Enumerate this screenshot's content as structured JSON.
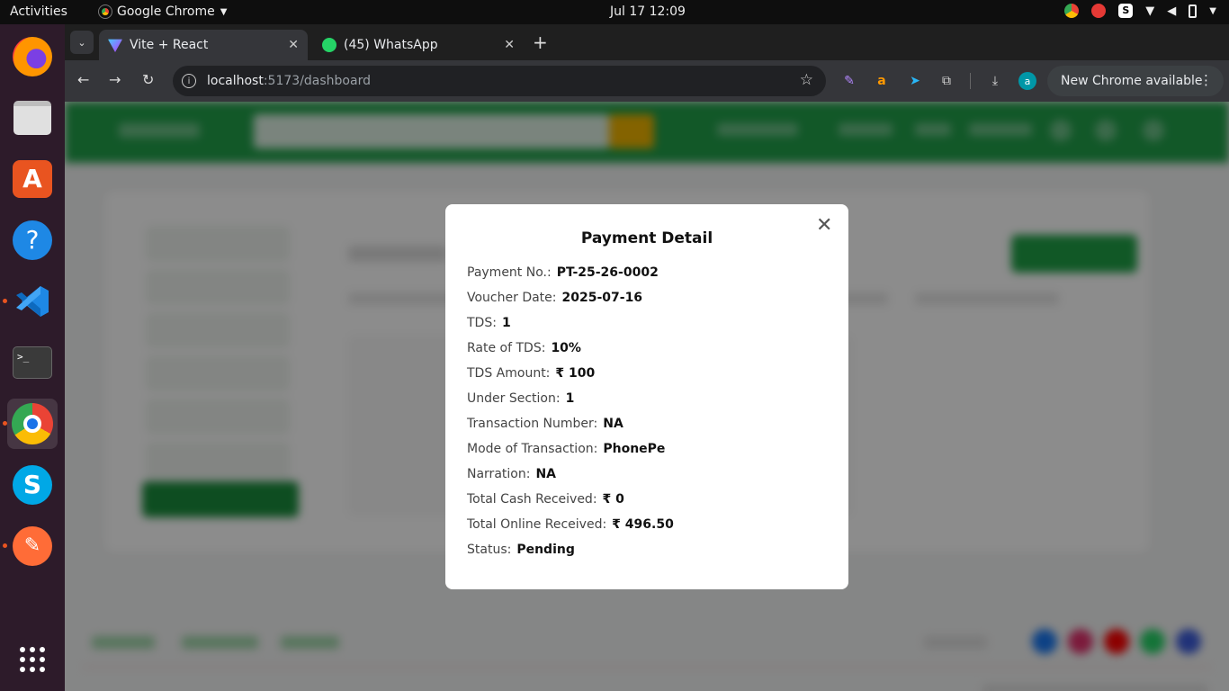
{
  "topbar": {
    "activities": "Activities",
    "app_name": "Google Chrome",
    "clock": "Jul 17  12:09"
  },
  "browser": {
    "tabs": [
      {
        "title": "Vite + React",
        "active": true
      },
      {
        "title": "(45) WhatsApp",
        "active": false
      }
    ],
    "url_host": "localhost",
    "url_rest": ":5173/dashboard",
    "update_label": "New Chrome available",
    "profile_initial": "a"
  },
  "modal": {
    "title": "Payment Detail",
    "fields": [
      {
        "label": "Payment No.:",
        "value": "PT-25-26-0002"
      },
      {
        "label": "Voucher Date:",
        "value": "2025-07-16"
      },
      {
        "label": "TDS:",
        "value": "1"
      },
      {
        "label": "Rate of TDS:",
        "value": "10%"
      },
      {
        "label": "TDS Amount:",
        "value": "₹ 100"
      },
      {
        "label": "Under Section:",
        "value": "1"
      },
      {
        "label": "Transaction Number:",
        "value": "NA"
      },
      {
        "label": "Mode of Transaction:",
        "value": "PhonePe"
      },
      {
        "label": "Narration:",
        "value": "NA"
      },
      {
        "label": "Total Cash Received:",
        "value": "₹ 0"
      },
      {
        "label": "Total Online Received:",
        "value": "₹ 496.50"
      },
      {
        "label": "Status:",
        "value": "Pending"
      }
    ]
  },
  "colors": {
    "header_green": "#21a04a",
    "dock_bg": "#2d1b2a",
    "accent_orange": "#e95420"
  }
}
